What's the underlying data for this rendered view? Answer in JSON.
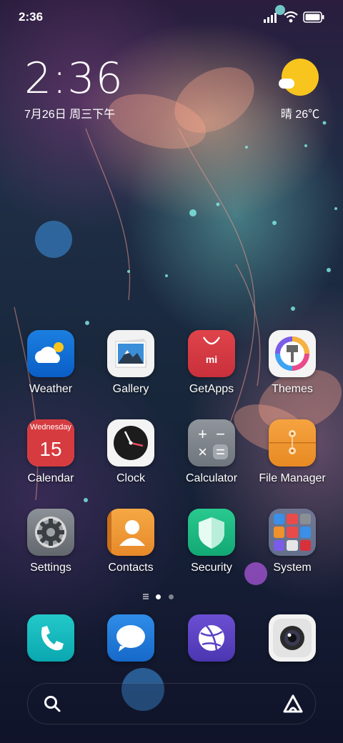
{
  "status_bar": {
    "time": "2:36",
    "icons": [
      "signal-icon",
      "wifi-icon",
      "battery-icon"
    ]
  },
  "clock_widget": {
    "time": "2:36",
    "date": "7月26日 周三下午"
  },
  "weather_widget": {
    "condition_icon": "sunny-cloud-icon",
    "text": "晴 26℃"
  },
  "apps": [
    {
      "label": "Weather"
    },
    {
      "label": "Gallery"
    },
    {
      "label": "GetApps",
      "icon_text": "mi"
    },
    {
      "label": "Themes"
    },
    {
      "label": "Calendar",
      "icon_weekday": "Wednesday",
      "icon_day": "15"
    },
    {
      "label": "Clock"
    },
    {
      "label": "Calculator",
      "icon_symbols": [
        "+",
        "−",
        "×",
        "="
      ]
    },
    {
      "label": "File Manager"
    },
    {
      "label": "Settings"
    },
    {
      "label": "Contacts"
    },
    {
      "label": "Security"
    },
    {
      "label": "System"
    }
  ],
  "dock": [
    {
      "name": "phone-icon"
    },
    {
      "name": "messages-icon"
    },
    {
      "name": "browser-icon"
    },
    {
      "name": "camera-icon"
    }
  ],
  "pager": {
    "pages": 2,
    "current": 1
  },
  "colors": {
    "accent_weather": "#1b7fe0",
    "getapps_red": "#d63b3f",
    "security_green": "#13a874",
    "sun_yellow": "#f7c51e"
  }
}
